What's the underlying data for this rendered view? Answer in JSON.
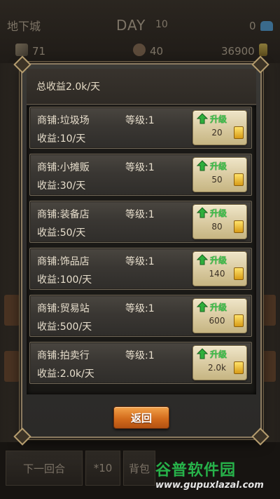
{
  "hud": {
    "location": "地下城",
    "day_label": "DAY",
    "day_number": "10",
    "gems": "0",
    "attack": "71",
    "population": "40",
    "gold": "36900"
  },
  "modal": {
    "title": "总收益2.0k/天",
    "back_label": "返回",
    "upgrade_label": "升级",
    "shops": [
      {
        "name": "商铺:垃圾场",
        "level": "等级:1",
        "income": "收益:10/天",
        "cost": "20"
      },
      {
        "name": "商铺:小摊贩",
        "level": "等级:1",
        "income": "收益:30/天",
        "cost": "50"
      },
      {
        "name": "商铺:装备店",
        "level": "等级:1",
        "income": "收益:50/天",
        "cost": "80"
      },
      {
        "name": "商铺:饰品店",
        "level": "等级:1",
        "income": "收益:100/天",
        "cost": "140"
      },
      {
        "name": "商铺:贸易站",
        "level": "等级:1",
        "income": "收益:500/天",
        "cost": "600"
      },
      {
        "name": "商铺:拍卖行",
        "level": "等级:1",
        "income": "收益:2.0k/天",
        "cost": "2.0k"
      }
    ]
  },
  "bottom_bar": {
    "next_round": "下一回合",
    "multiplier": "*10",
    "bag": "背包"
  },
  "watermark": {
    "name": "谷普软件园",
    "url": "www.gupuxlazal.com"
  },
  "colors": {
    "upgrade_green": "#3ec24a",
    "back_orange": "#d36c1c",
    "panel_border": "#8a7a60"
  }
}
